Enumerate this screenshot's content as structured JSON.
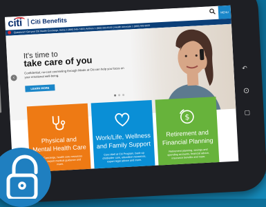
{
  "header": {
    "logo": "citi",
    "site_title": "Citi Benefits",
    "search_icon": "search-icon",
    "menu_label": "MENU"
  },
  "contact_bar": {
    "text": "Questions? Get your Citi Health Concierge, Aetna 1 (800) 545-7463 | Anthem 1 (800) 553-8133 | Health Advocate 1 (866) 449-9933"
  },
  "hero": {
    "title_line1": "It's time to",
    "title_line2": "take care of you",
    "copy": "Confidential, no-cost counseling through Minds at Citi can help you focus on your emotional well-being.",
    "button_label": "LEARN MORE",
    "slide_count": 3,
    "active_slide": 1
  },
  "cards": [
    {
      "title": "Physical and Mental Health Care",
      "desc": "With Concierge, health care resources at Citi, expert medical guidance and more.",
      "icon": "stethoscope-icon",
      "color": "#ee7a14"
    },
    {
      "title": "Work/Life, Wellness and Family Support",
      "desc": "Core Well at Citi Program, back-up child/elder care, education resources, expert legal advice and more.",
      "icon": "heart-icon",
      "color": "#0a8fd6"
    },
    {
      "title": "Retirement and Financial Planning",
      "desc": "Retirement planning, savings and spending accounts, financial advice, insurance benefits and more.",
      "icon": "dollar-icon",
      "color": "#67b33b"
    }
  ],
  "colors": {
    "brand_navy": "#0a2f6e",
    "brand_red": "#d8282f",
    "accent_blue": "#1a86c8",
    "background": "#0d6f99"
  }
}
